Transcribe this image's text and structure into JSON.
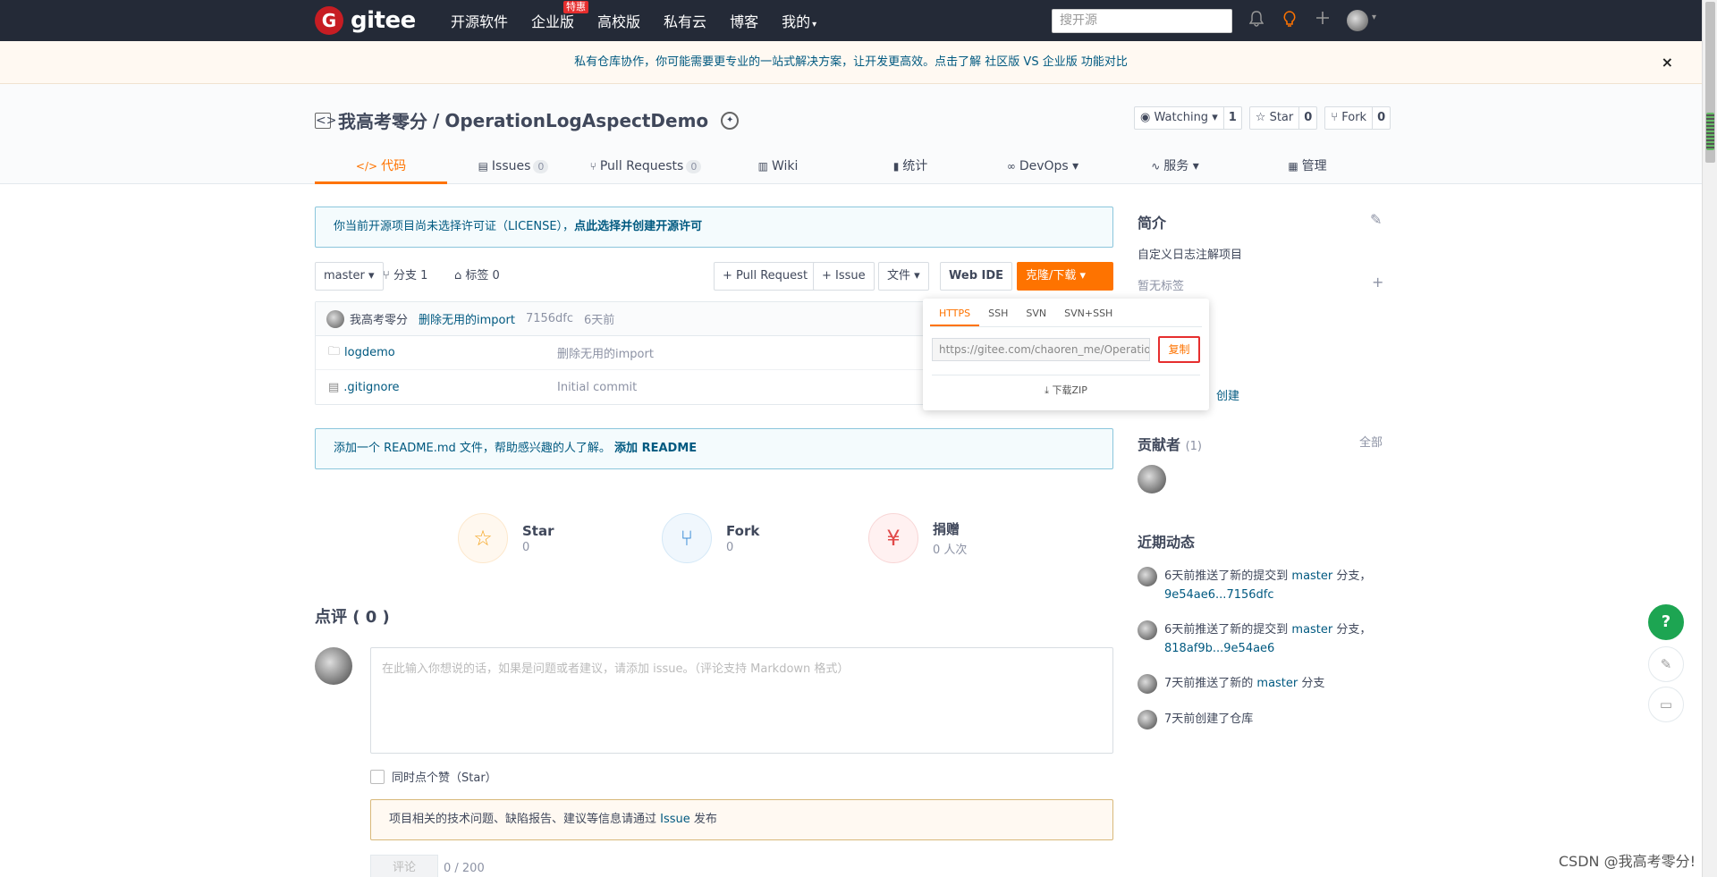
{
  "topnav": {
    "logo_text": "gitee",
    "items": [
      {
        "label": "开源软件"
      },
      {
        "label": "企业版",
        "badge": "特惠"
      },
      {
        "label": "高校版"
      },
      {
        "label": "私有云"
      },
      {
        "label": "博客"
      },
      {
        "label": "我的"
      }
    ],
    "search_placeholder": "搜开源",
    "icons": [
      "bell-icon",
      "bulb-icon",
      "plus-icon",
      "avatar"
    ]
  },
  "banner": {
    "text": "私有仓库协作，你可能需要更专业的一站式解决方案，让开发更高效。点击了解 社区版 VS 企业版 功能对比",
    "close": "×"
  },
  "project": {
    "owner": "我高考零分",
    "separator": "/",
    "name": "OperationLogAspectDemo",
    "watching_label": "Watching",
    "watching_count": "1",
    "star_label": "Star",
    "star_count": "0",
    "fork_label": "Fork",
    "fork_count": "0"
  },
  "tabs": [
    {
      "icon": "</>",
      "label": "代码"
    },
    {
      "icon": "▤",
      "label": "Issues",
      "count": "0"
    },
    {
      "icon": "⑂",
      "label": "Pull Requests",
      "count": "0"
    },
    {
      "icon": "▥",
      "label": "Wiki"
    },
    {
      "icon": "▮",
      "label": "统计"
    },
    {
      "icon": "∞",
      "label": "DevOps"
    },
    {
      "icon": "∿",
      "label": "服务"
    },
    {
      "icon": "▦",
      "label": "管理"
    }
  ],
  "license_notice": {
    "text": "你当前开源项目尚未选择许可证（LICENSE），",
    "link": "点此选择并创建开源许可"
  },
  "toolbar": {
    "branch": "master",
    "branches_label": "分支 1",
    "tags_label": "标签 0",
    "pr_button": "+ Pull Request",
    "issue_button": "+ Issue",
    "file_button": "文件",
    "webide_button": "Web IDE",
    "clone_button": "克隆/下载"
  },
  "commit": {
    "author": "我高考零分",
    "message": "删除无用的import",
    "hash": "7156dfc",
    "time": "6天前"
  },
  "files": [
    {
      "icon": "folder-icon",
      "name": "logdemo",
      "message": "删除无用的import"
    },
    {
      "icon": "file-icon",
      "name": ".gitignore",
      "message": "Initial commit"
    }
  ],
  "clone": {
    "tabs": [
      "HTTPS",
      "SSH",
      "SVN",
      "SVN+SSH"
    ],
    "url": "https://gitee.com/chaoren_me/OperationLogAspectDemo.git",
    "copy": "复制",
    "download": "下载ZIP"
  },
  "readme_notice": {
    "text": "添加一个 README.md 文件，帮助感兴趣的人了解。",
    "link": "添加 README"
  },
  "stats": [
    {
      "name": "Star",
      "value": "0"
    },
    {
      "name": "Fork",
      "value": "0"
    },
    {
      "name": "捐赠",
      "value": "0 人次"
    }
  ],
  "comments": {
    "title": "点评 ( 0 )",
    "placeholder": "在此输入你想说的话，如果是问题或者建议，请添加 issue。（评论支持 Markdown 格式）",
    "star_check": "同时点个赞（Star）",
    "warn_text": "项目相关的技术问题、缺陷报告、建议等信息请通过",
    "warn_link": "Issue",
    "warn_tail": "发布",
    "submit": "评论",
    "counter": "0 / 200"
  },
  "sidebar": {
    "intro_title": "简介",
    "intro_text": "自定义日志注解项目",
    "no_tags": "暂无标签",
    "created": "创建",
    "contributors_title": "贡献者",
    "contributors_count": "(1)",
    "contributors_all": "全部",
    "activity_title": "近期动态",
    "activities": [
      {
        "pre": "6天前推送了新的提交到 ",
        "branch": "master",
        "mid": " 分支，",
        "link": "9e54ae6...7156dfc"
      },
      {
        "pre": "6天前推送了新的提交到 ",
        "branch": "master",
        "mid": " 分支，",
        "link": "818af9b...9e54ae6"
      },
      {
        "pre": "7天前推送了新的 ",
        "branch": "master",
        "mid": " 分支",
        "link": ""
      },
      {
        "pre": "7天前创建了仓库",
        "branch": "",
        "mid": "",
        "link": ""
      }
    ]
  },
  "watermark": "CSDN @我高考零分!"
}
